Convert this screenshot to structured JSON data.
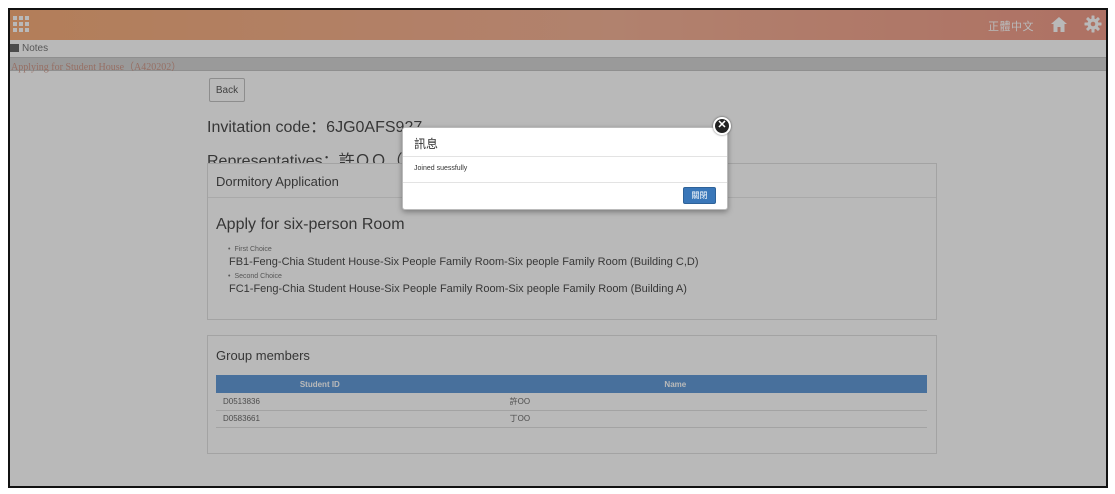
{
  "topbar": {
    "language_link": "正體中文"
  },
  "notes": {
    "label": "Notes"
  },
  "breadcrumb": {
    "title": "Applying for Student House（A420202）"
  },
  "content": {
    "back_label": "Back",
    "invitation": "Invitation code：6JG0AFS927",
    "representatives": "Representatives：許ＯＯ（M"
  },
  "dormitory": {
    "header": "Dormitory Application",
    "room_title": "Apply for six-person Room",
    "choices": [
      {
        "label": "First Choice",
        "value": "FB1-Feng-Chia Student House-Six People Family Room-Six people Family Room (Building C,D)"
      },
      {
        "label": "Second Choice",
        "value": "FC1-Feng-Chia Student House-Six People Family Room-Six people Family Room (Building A)"
      }
    ]
  },
  "group": {
    "title": "Group members",
    "columns": [
      "Student ID",
      "Name"
    ],
    "rows": [
      [
        "D0513836",
        "許OO"
      ],
      [
        "D0583661",
        "丁OO"
      ]
    ]
  },
  "dialog": {
    "title": "訊息",
    "message": "Joined suessfully",
    "ok_label": "關閉",
    "close_glyph": "✕"
  },
  "colors": {
    "topbar_start": "#f6a36a",
    "topbar_end": "#ee8f7a",
    "accent_blue": "#4f8ed2",
    "ok_button": "#3a77b9"
  }
}
